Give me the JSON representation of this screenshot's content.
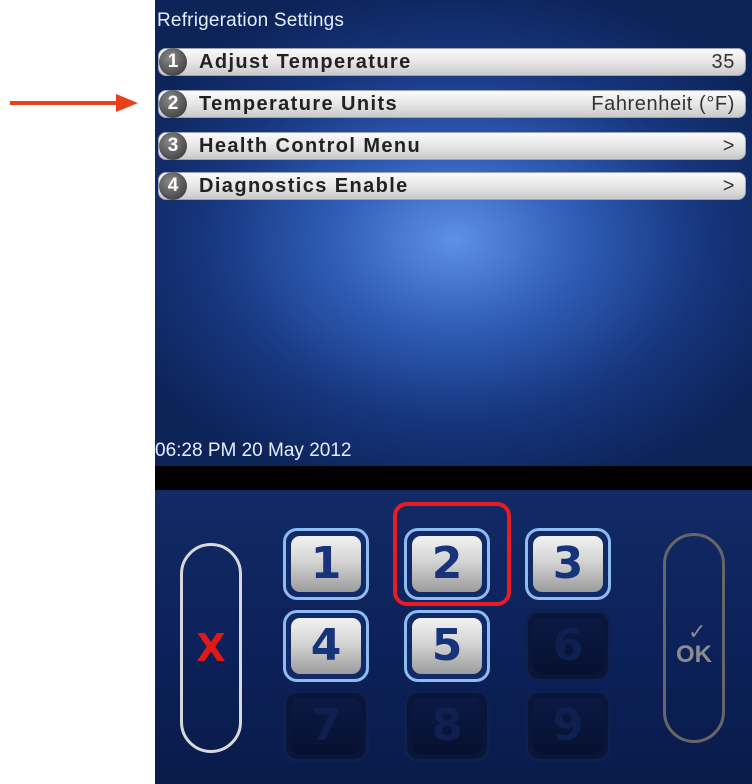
{
  "screen": {
    "title": "Refrigeration Settings",
    "menu": [
      {
        "num": "1",
        "label": "Adjust Temperature",
        "value": "35"
      },
      {
        "num": "2",
        "label": "Temperature Units",
        "value": "Fahrenheit (°F)"
      },
      {
        "num": "3",
        "label": "Health Control Menu",
        "value": ">"
      },
      {
        "num": "4",
        "label": "Diagnostics Enable",
        "value": ">"
      }
    ],
    "datetime": "06:28 PM 20 May 2012"
  },
  "keypad": {
    "cancel_label": "X",
    "ok_check": "✓",
    "ok_label": "OK",
    "keys": [
      {
        "label": "1",
        "enabled": true
      },
      {
        "label": "2",
        "enabled": true,
        "highlighted": true
      },
      {
        "label": "3",
        "enabled": true
      },
      {
        "label": "4",
        "enabled": true
      },
      {
        "label": "5",
        "enabled": true
      },
      {
        "label": "6",
        "enabled": false
      },
      {
        "label": "7",
        "enabled": false
      },
      {
        "label": "8",
        "enabled": false
      },
      {
        "label": "9",
        "enabled": false
      }
    ]
  },
  "colors": {
    "annotation": "#e8401a",
    "highlight": "#e81c24",
    "cancel_x": "#e01818",
    "key_text": "#17347a"
  }
}
